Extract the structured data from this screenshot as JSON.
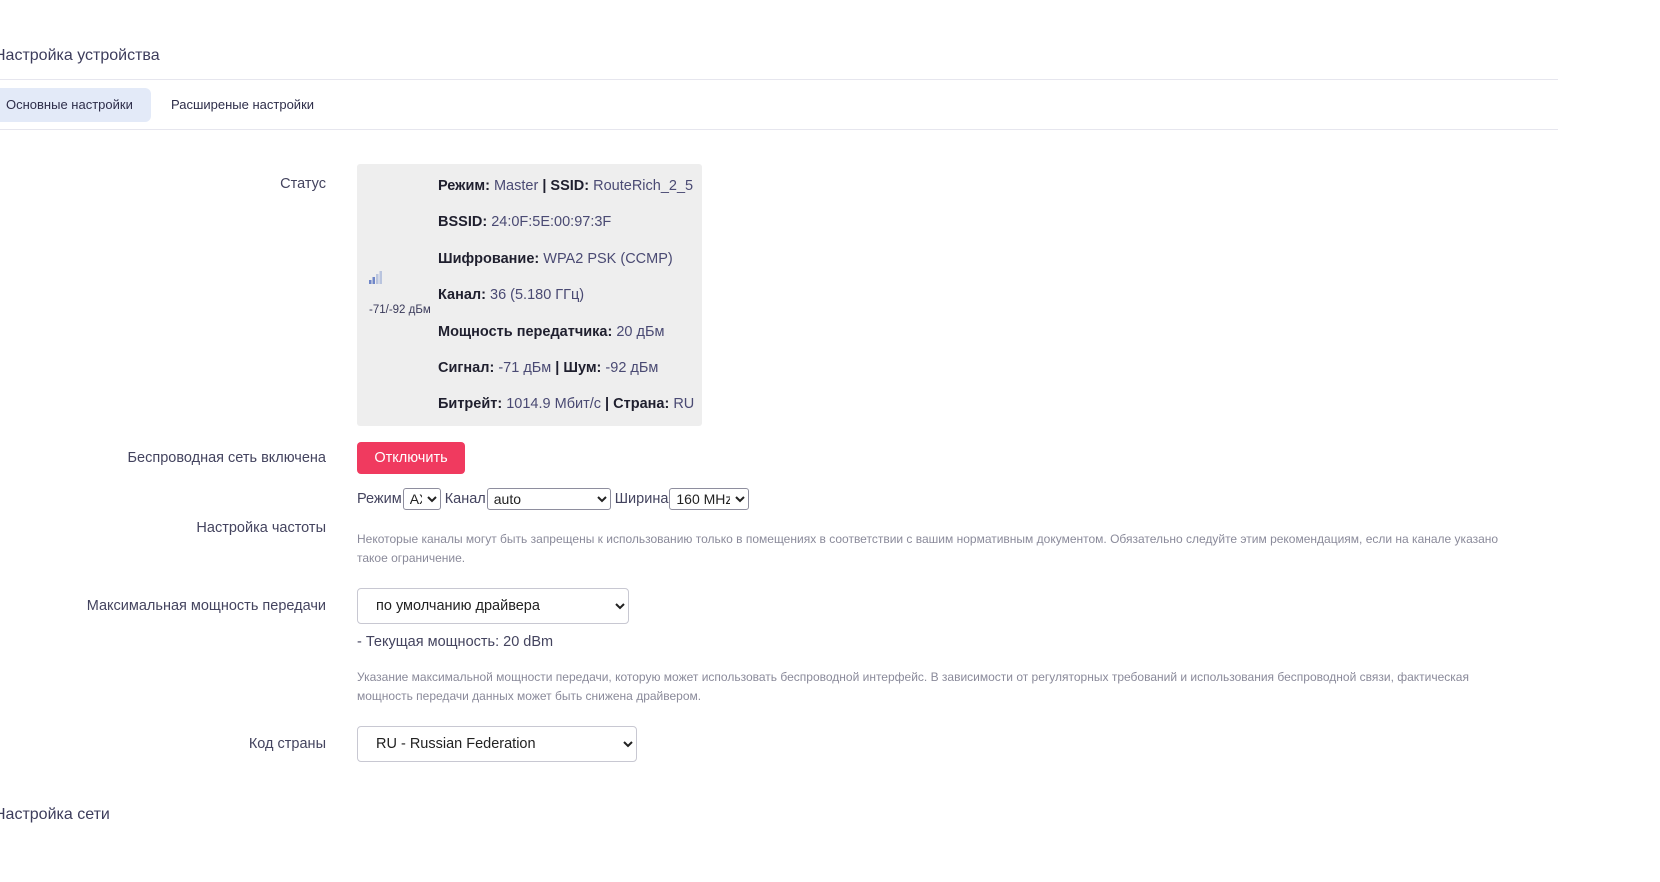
{
  "header": {
    "device_settings_title": "Настройка устройства",
    "network_settings_title": "Настройка сети"
  },
  "tabs": [
    {
      "label": "Основные настройки",
      "active": true
    },
    {
      "label": "Расширеные настройки",
      "active": false
    }
  ],
  "status": {
    "label": "Статус",
    "signal_icon": "signal-bars-icon",
    "signal_text": "-71/-92 дБм",
    "mode_key": "Режим:",
    "mode_val": "Master",
    "ssid_key": "SSID:",
    "ssid_val": "RouteRich_2_5",
    "bssid_key": "BSSID:",
    "bssid_val": "24:0F:5E:00:97:3F",
    "enc_key": "Шифрование:",
    "enc_val": "WPA2 PSK (CCMP)",
    "channel_key": "Канал:",
    "channel_val": "36 (5.180 ГГц)",
    "txpower_key": "Мощность передатчика:",
    "txpower_val": "20 дБм",
    "signal_key": "Сигнал:",
    "signal_val": "-71 дБм",
    "noise_key": "Шум:",
    "noise_val": "-92 дБм",
    "bitrate_key": "Битрейт:",
    "bitrate_val": "1014.9 Мбит/с",
    "country_key": "Страна:",
    "country_val": "RU",
    "separator": "|"
  },
  "wireless": {
    "label": "Беспроводная сеть включена",
    "button": "Отключить"
  },
  "frequency": {
    "label": "Настройка частоты",
    "mode_label": "Режим",
    "mode_value": "AX",
    "channel_label": "Канал",
    "channel_value": "auto",
    "width_label": "Ширина",
    "width_value": "160 MHz",
    "hint": "Некоторые каналы могут быть запрещены к использованию только в помещениях в соответствии с вашим нормативным документом. Обязательно следуйте этим рекомендациям, если на канале указано такое ограничение."
  },
  "txpower": {
    "label": "Максимальная мощность передачи",
    "value": "по умолчанию драйвера",
    "current": "- Текущая мощность: 20 dBm",
    "hint": "Указание максимальной мощности передачи, которую может использовать беспроводной интерфейс. В зависимости от регуляторных требований и использования беспроводной связи, фактическая мощность передачи данных может быть снижена драйвером."
  },
  "country": {
    "label": "Код страны",
    "value": "RU - Russian Federation"
  },
  "colors": {
    "accent_red": "#f03a5f",
    "active_tab_bg": "#e3eaf8",
    "status_bg": "#eeeeee"
  }
}
